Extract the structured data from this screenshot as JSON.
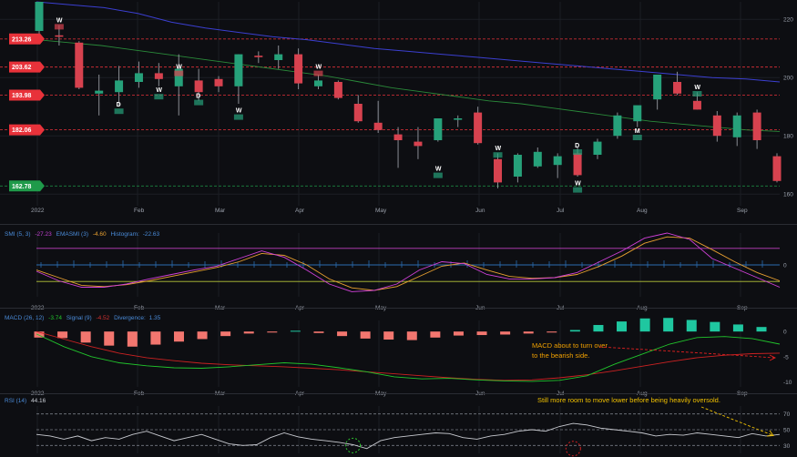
{
  "chart_data": {
    "type": "candlestick-with-indicators",
    "x_months": [
      "2022",
      "Feb",
      "Mar",
      "Apr",
      "May",
      "Jun",
      "Jul",
      "Aug",
      "Sep"
    ],
    "price_panel": {
      "y_ticks": [
        220,
        200,
        180,
        160
      ],
      "y_range": [
        156,
        226
      ],
      "level_lines": [
        {
          "label": "213.26",
          "value": 213.26,
          "color": "#e8323a"
        },
        {
          "label": "203.62",
          "value": 203.62,
          "color": "#e8323a"
        },
        {
          "label": "193.98",
          "value": 193.98,
          "color": "#e8323a"
        },
        {
          "label": "182.06",
          "value": 182.06,
          "color": "#e8323a"
        },
        {
          "label": "162.78",
          "value": 162.78,
          "color": "#1f9a4a"
        }
      ],
      "candles": [
        {
          "o": 216.0,
          "h": 226.0,
          "l": 212.0,
          "c": 226.0
        },
        {
          "o": 214.5,
          "h": 218.0,
          "l": 211.0,
          "c": 214.0
        },
        {
          "o": 212.0,
          "h": 212.5,
          "l": 196.0,
          "c": 196.5
        },
        {
          "o": 194.5,
          "h": 201.0,
          "l": 187.0,
          "c": 195.5
        },
        {
          "o": 195.0,
          "h": 204.0,
          "l": 190.0,
          "c": 199.0
        },
        {
          "o": 198.5,
          "h": 205.5,
          "l": 196.5,
          "c": 201.5
        },
        {
          "o": 201.5,
          "h": 205.0,
          "l": 197.0,
          "c": 199.5
        },
        {
          "o": 197.0,
          "h": 208.0,
          "l": 187.0,
          "c": 203.0
        },
        {
          "o": 199.0,
          "h": 203.0,
          "l": 192.0,
          "c": 195.0
        },
        {
          "o": 199.5,
          "h": 200.5,
          "l": 195.0,
          "c": 197.0
        },
        {
          "o": 197.0,
          "h": 208.0,
          "l": 191.0,
          "c": 208.0
        },
        {
          "o": 207.5,
          "h": 209.0,
          "l": 205.0,
          "c": 207.0
        },
        {
          "o": 206.0,
          "h": 211.0,
          "l": 203.0,
          "c": 208.0
        },
        {
          "o": 208.0,
          "h": 210.0,
          "l": 196.0,
          "c": 198.0
        },
        {
          "o": 197.0,
          "h": 201.0,
          "l": 196.0,
          "c": 199.0
        },
        {
          "o": 198.5,
          "h": 199.0,
          "l": 192.5,
          "c": 193.0
        },
        {
          "o": 191.0,
          "h": 194.0,
          "l": 184.5,
          "c": 185.0
        },
        {
          "o": 184.5,
          "h": 192.0,
          "l": 181.0,
          "c": 182.0
        },
        {
          "o": 180.5,
          "h": 183.0,
          "l": 169.0,
          "c": 178.5
        },
        {
          "o": 178.0,
          "h": 183.0,
          "l": 172.0,
          "c": 176.5
        },
        {
          "o": 178.5,
          "h": 186.0,
          "l": 178.0,
          "c": 186.0
        },
        {
          "o": 185.5,
          "h": 187.0,
          "l": 183.0,
          "c": 186.0
        },
        {
          "o": 188.0,
          "h": 190.0,
          "l": 177.0,
          "c": 177.5
        },
        {
          "o": 172.0,
          "h": 174.0,
          "l": 162.0,
          "c": 164.0
        },
        {
          "o": 166.0,
          "h": 174.0,
          "l": 164.0,
          "c": 173.5
        },
        {
          "o": 169.5,
          "h": 176.0,
          "l": 169.0,
          "c": 174.5
        },
        {
          "o": 170.0,
          "h": 174.0,
          "l": 165.5,
          "c": 173.0
        },
        {
          "o": 174.0,
          "h": 176.0,
          "l": 166.0,
          "c": 166.5
        },
        {
          "o": 173.5,
          "h": 179.0,
          "l": 172.0,
          "c": 178.0
        },
        {
          "o": 180.0,
          "h": 188.0,
          "l": 179.0,
          "c": 187.0
        },
        {
          "o": 185.0,
          "h": 190.0,
          "l": 183.0,
          "c": 190.5
        },
        {
          "o": 192.5,
          "h": 200.0,
          "l": 189.0,
          "c": 201.0
        },
        {
          "o": 198.5,
          "h": 202.0,
          "l": 194.0,
          "c": 194.5
        },
        {
          "o": 192.0,
          "h": 195.0,
          "l": 189.0,
          "c": 189.0
        },
        {
          "o": 187.0,
          "h": 188.5,
          "l": 178.0,
          "c": 180.0
        },
        {
          "o": 179.5,
          "h": 188.0,
          "l": 176.5,
          "c": 187.0
        },
        {
          "o": 188.0,
          "h": 189.0,
          "l": 175.5,
          "c": 178.5
        },
        {
          "o": 173.0,
          "h": 174.0,
          "l": 164.0,
          "c": 164.5
        }
      ],
      "ma_long": {
        "color": "#3b3fd0",
        "values": [
          226,
          225,
          224,
          222,
          219,
          217,
          215.5,
          214,
          213,
          211.5,
          210,
          209,
          208,
          207,
          206,
          205,
          204,
          203,
          202,
          201,
          200,
          199.5,
          198.5
        ]
      },
      "ma_mid": {
        "color": "#2a8a3a",
        "values": [
          213,
          212,
          211,
          209.5,
          208,
          206.5,
          205,
          203.5,
          202,
          200.5,
          198.5,
          196.5,
          195,
          193.5,
          192,
          191,
          189.5,
          188,
          186.5,
          185,
          184,
          183,
          182,
          181.5
        ]
      },
      "markers": [
        {
          "label": "W",
          "i": 1,
          "price": 219
        },
        {
          "label": "D",
          "i": 4,
          "price": 190
        },
        {
          "label": "W",
          "i": 6,
          "price": 195
        },
        {
          "label": "W",
          "i": 7,
          "price": 203
        },
        {
          "label": "D",
          "i": 8,
          "price": 193
        },
        {
          "label": "W",
          "i": 10,
          "price": 188
        },
        {
          "label": "W",
          "i": 14,
          "price": 203
        },
        {
          "label": "W",
          "i": 20,
          "price": 168
        },
        {
          "label": "W",
          "i": 23,
          "price": 175
        },
        {
          "label": "D",
          "i": 27,
          "price": 176
        },
        {
          "label": "W",
          "i": 27,
          "price": 163
        },
        {
          "label": "M",
          "i": 30,
          "price": 181
        },
        {
          "label": "W",
          "i": 33,
          "price": 196
        }
      ]
    },
    "smi_panel": {
      "legend": {
        "name": "SMI (5, 3)",
        "smi": "-27.23",
        "ema_name": "EMASMI (3)",
        "ema": "-4.60",
        "hist_name": "Histogram:",
        "hist": "-22.63"
      },
      "y_ticks": [
        0
      ],
      "y_range": [
        -50,
        50
      ],
      "upper_band": 26,
      "lower_band": -26,
      "smi": {
        "color": "#d040d8",
        "values": [
          -10,
          -25,
          -35,
          -35,
          -30,
          -22,
          -15,
          -8,
          -2,
          10,
          22,
          12,
          -8,
          -30,
          -42,
          -40,
          -30,
          -8,
          5,
          2,
          -15,
          -22,
          -22,
          -20,
          -12,
          5,
          22,
          42,
          50,
          40,
          10,
          -5,
          -20,
          -35
        ]
      },
      "ema": {
        "color": "#e8a030",
        "values": [
          -8,
          -20,
          -32,
          -34,
          -31,
          -25,
          -18,
          -11,
          -4,
          5,
          18,
          15,
          0,
          -22,
          -36,
          -40,
          -34,
          -18,
          -2,
          3,
          -8,
          -18,
          -21,
          -20,
          -15,
          -2,
          14,
          34,
          44,
          42,
          24,
          5,
          -12,
          -25
        ]
      }
    },
    "macd_panel": {
      "legend": {
        "name": "MACD (26, 12)",
        "macd": "-3.74",
        "signal_name": "Signal (9)",
        "signal": "-4.52",
        "div_name": "Divergence:",
        "div": "1.35"
      },
      "y_ticks": [
        0,
        -5,
        -10
      ],
      "y_range": [
        -11,
        2.2
      ],
      "histogram": [
        -1.2,
        -1.3,
        -2.2,
        -2.8,
        -3.0,
        -2.6,
        -2.0,
        -1.5,
        -0.9,
        -0.4,
        -0.2,
        0.15,
        -0.3,
        -0.9,
        -1.4,
        -1.6,
        -1.7,
        -1.2,
        -0.8,
        -0.7,
        -0.6,
        -0.4,
        -0.2,
        0.3,
        1.3,
        2.0,
        2.6,
        2.7,
        2.3,
        1.9,
        1.4,
        0.9
      ],
      "macd": {
        "color": "#21c52c",
        "values": [
          -0.5,
          -3,
          -5,
          -6.2,
          -6.8,
          -7.2,
          -7.3,
          -7,
          -6.6,
          -6.2,
          -6.5,
          -7.2,
          -8,
          -9,
          -9.4,
          -9.3,
          -9.6,
          -9.8,
          -9.9,
          -9.7,
          -8.8,
          -6.5,
          -4.5,
          -2.5,
          -1.2,
          -1.0,
          -1.4,
          -2.5
        ]
      },
      "signal": {
        "color": "#cc2222",
        "values": [
          0,
          -1.5,
          -3,
          -4.3,
          -5.2,
          -5.8,
          -6.3,
          -6.6,
          -6.8,
          -7,
          -7.3,
          -7.6,
          -8,
          -8.4,
          -8.8,
          -9.2,
          -9.5,
          -9.7,
          -9.6,
          -9.2,
          -8.6,
          -7.8,
          -6.9,
          -6.0,
          -5.2,
          -4.7,
          -4.4,
          -4.3
        ]
      },
      "annotation": {
        "line1": "MACD about to turn over",
        "line2": "to the bearish side.",
        "color": "#f0a000"
      }
    },
    "rsi_panel": {
      "legend": {
        "name": "RSI (14)",
        "value": "44.16"
      },
      "y_ticks": [
        70,
        50,
        30
      ],
      "y_range": [
        20,
        80
      ],
      "values": [
        44,
        42,
        38,
        42,
        36,
        40,
        38,
        44,
        48,
        42,
        36,
        40,
        44,
        38,
        32,
        30,
        31,
        40,
        46,
        41,
        38,
        36,
        34,
        31,
        26,
        36,
        40,
        42,
        44,
        46,
        45,
        40,
        38,
        42,
        44,
        48,
        50,
        48,
        54,
        58,
        56,
        52,
        50,
        48,
        46,
        42,
        44,
        43,
        46,
        44,
        42,
        40,
        45,
        42,
        44
      ],
      "circles": [
        {
          "i": 14,
          "value": 30,
          "color": "#2ec82e"
        },
        {
          "i": 24,
          "value": 26,
          "color": "#d02020"
        }
      ],
      "annotation": {
        "text": "Still more room to move lower before being heavily oversold.",
        "color": "#f0c000"
      }
    }
  }
}
